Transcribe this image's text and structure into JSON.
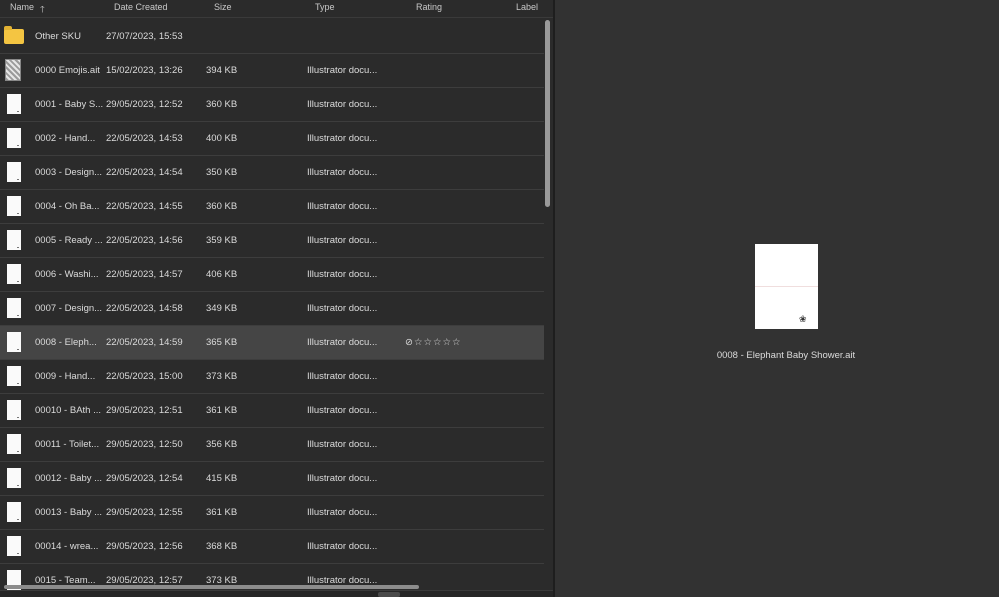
{
  "header": {
    "name": "Name",
    "date_created": "Date Created",
    "size": "Size",
    "type": "Type",
    "rating": "Rating",
    "label": "Label",
    "sort_icon": "arrow-up-icon"
  },
  "rows": [
    {
      "name": "Other SKU",
      "date": "27/07/2023, 15:53",
      "size": "",
      "type": "",
      "thumb": "folder"
    },
    {
      "name": "0000 Emojis.ait",
      "date": "15/02/2023, 13:26",
      "size": "394 KB",
      "type": "Illustrator docu...",
      "thumb": "emoji"
    },
    {
      "name": "0001 - Baby S...",
      "date": "29/05/2023, 12:52",
      "size": "360 KB",
      "type": "Illustrator docu...",
      "thumb": "doc"
    },
    {
      "name": "0002 - Hand...",
      "date": "22/05/2023, 14:53",
      "size": "400 KB",
      "type": "Illustrator docu...",
      "thumb": "doc"
    },
    {
      "name": "0003 - Design...",
      "date": "22/05/2023, 14:54",
      "size": "350 KB",
      "type": "Illustrator docu...",
      "thumb": "doc"
    },
    {
      "name": "0004 - Oh Ba...",
      "date": "22/05/2023, 14:55",
      "size": "360 KB",
      "type": "Illustrator docu...",
      "thumb": "doc"
    },
    {
      "name": "0005 - Ready ...",
      "date": "22/05/2023, 14:56",
      "size": "359 KB",
      "type": "Illustrator docu...",
      "thumb": "doc"
    },
    {
      "name": "0006 - Washi...",
      "date": "22/05/2023, 14:57",
      "size": "406 KB",
      "type": "Illustrator docu...",
      "thumb": "doc"
    },
    {
      "name": "0007 - Design...",
      "date": "22/05/2023, 14:58",
      "size": "349 KB",
      "type": "Illustrator docu...",
      "thumb": "doc"
    },
    {
      "name": "0008 - Eleph...",
      "date": "22/05/2023, 14:59",
      "size": "365 KB",
      "type": "Illustrator docu...",
      "thumb": "doc",
      "selected": true,
      "rating": "⊘☆☆☆☆☆"
    },
    {
      "name": "0009 - Hand...",
      "date": "22/05/2023, 15:00",
      "size": "373 KB",
      "type": "Illustrator docu...",
      "thumb": "doc"
    },
    {
      "name": "00010 - BAth ...",
      "date": "29/05/2023, 12:51",
      "size": "361 KB",
      "type": "Illustrator docu...",
      "thumb": "doc"
    },
    {
      "name": "00011 - Toilet...",
      "date": "29/05/2023, 12:50",
      "size": "356 KB",
      "type": "Illustrator docu...",
      "thumb": "doc"
    },
    {
      "name": "00012 - Baby ...",
      "date": "29/05/2023, 12:54",
      "size": "415 KB",
      "type": "Illustrator docu...",
      "thumb": "doc"
    },
    {
      "name": "00013 - Baby ...",
      "date": "29/05/2023, 12:55",
      "size": "361 KB",
      "type": "Illustrator docu...",
      "thumb": "doc"
    },
    {
      "name": "00014 - wrea...",
      "date": "29/05/2023, 12:56",
      "size": "368 KB",
      "type": "Illustrator docu...",
      "thumb": "doc"
    },
    {
      "name": "0015 - Team...",
      "date": "29/05/2023, 12:57",
      "size": "373 KB",
      "type": "Illustrator docu...",
      "thumb": "doc"
    }
  ],
  "preview": {
    "filename": "0008 - Elephant Baby Shower.ait"
  }
}
